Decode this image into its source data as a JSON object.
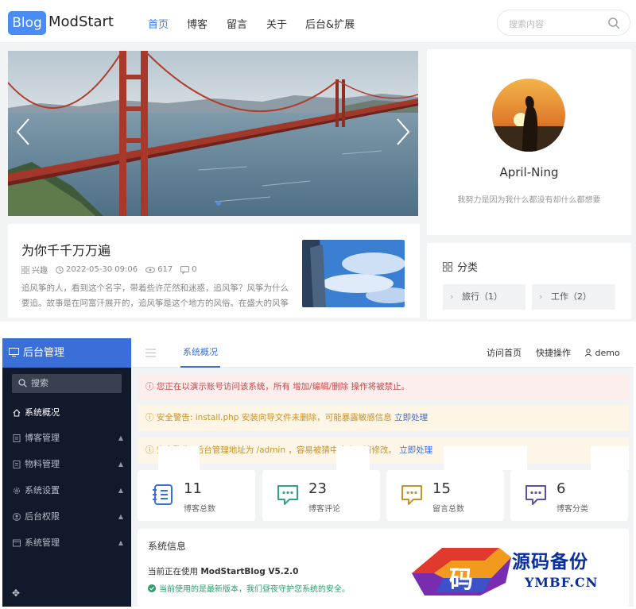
{
  "blog": {
    "logo": {
      "badge": "Blog",
      "name": "ModStart"
    },
    "nav": [
      "首页",
      "博客",
      "留言",
      "关于",
      "后台&扩展"
    ],
    "active_nav": "首页",
    "search": {
      "placeholder": "搜索内容"
    },
    "post": {
      "title": "为你千千万万遍",
      "category": "兴趣",
      "datetime": "2022-05-30 09:06",
      "views": "617",
      "comments": "0",
      "excerpt": "追风筝的人，看到这个名字，带着些许茫然和迷惑，追风筝？风筝为什么要追。故事是在阿富汗展开的，追风筝是这个地方的风俗。在盛大的风筝"
    },
    "profile": {
      "name": "April-Ning",
      "motto": "我努力是因为我什么都没有却什么都想要"
    },
    "categories": {
      "title": "分类",
      "items": [
        "旅行（1）",
        "工作（2）"
      ]
    }
  },
  "admin": {
    "title": "后台管理",
    "search_label": "搜索",
    "menu": [
      {
        "label": "系统概况",
        "active": true,
        "icon": "home-icon",
        "caret": ""
      },
      {
        "label": "博客管理",
        "active": false,
        "icon": "document-icon",
        "caret": "▲"
      },
      {
        "label": "物料管理",
        "active": false,
        "icon": "document-icon",
        "caret": "▲"
      },
      {
        "label": "系统设置",
        "active": false,
        "icon": "gear-icon",
        "caret": "▲"
      },
      {
        "label": "后台权限",
        "active": false,
        "icon": "user-icon",
        "caret": "▲"
      },
      {
        "label": "系统管理",
        "active": false,
        "icon": "window-icon",
        "caret": "▲"
      }
    ],
    "top": {
      "tab": "系统概况",
      "links": [
        "访问首页",
        "快捷操作"
      ],
      "user": "demo"
    },
    "alerts": {
      "a1": {
        "text": "您正在以演示账号访问该系统，所有 增加/编辑/删除 操作将被禁止。"
      },
      "a2": {
        "text": "安全警告: install.php 安装向导文件未删除，可能暴露敏感信息",
        "link": "立即处理"
      },
      "a3": {
        "text": "安全警告: 后台管理地址为 /admin ，容易被猜中攻击，请修改。",
        "link": "立即处理"
      }
    },
    "stats": [
      {
        "value": "11",
        "label": "博客总数",
        "icon": "notebook-icon",
        "color": "#3b6fd8"
      },
      {
        "value": "23",
        "label": "博客评论",
        "icon": "chat-icon",
        "color": "#2aa58a"
      },
      {
        "value": "15",
        "label": "留言总数",
        "icon": "chat-icon",
        "color": "#c8922a"
      },
      {
        "value": "6",
        "label": "博客分类",
        "icon": "chat-icon",
        "color": "#5b4fa8"
      }
    ],
    "sysinfo": {
      "title": "系统信息",
      "version_prefix": "当前正在使用",
      "version": "ModStartBlog V5.2.0",
      "status": "当前使用的是最新版本，我们昼夜守护您系统的安全。"
    }
  },
  "watermark": {
    "logo_char": "码",
    "cn": "源码备份",
    "en": "YMBF.CN"
  }
}
